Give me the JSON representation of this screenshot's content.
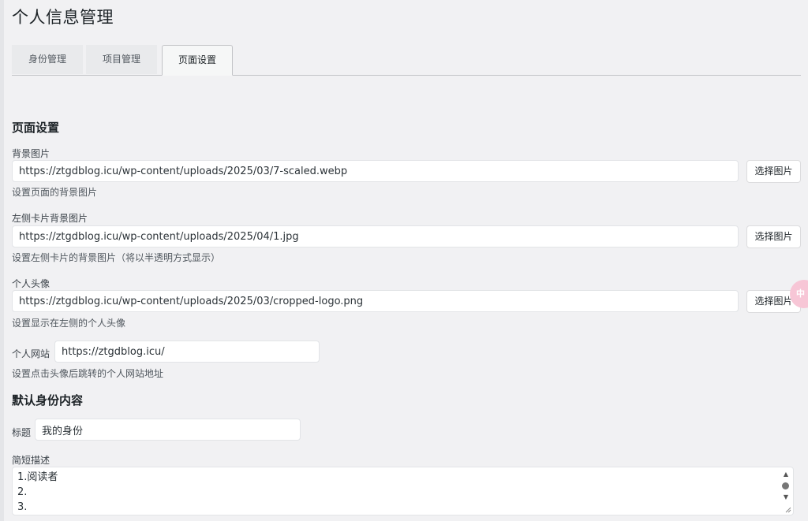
{
  "page": {
    "title": "个人信息管理"
  },
  "tabs": [
    {
      "label": "身份管理",
      "active": false
    },
    {
      "label": "项目管理",
      "active": false
    },
    {
      "label": "页面设置",
      "active": true
    }
  ],
  "page_settings": {
    "heading": "页面设置",
    "background_image": {
      "label": "背景图片",
      "value": "https://ztgdblog.icu/wp-content/uploads/2025/03/7-scaled.webp",
      "button": "选择图片",
      "description": "设置页面的背景图片"
    },
    "left_card_background": {
      "label": "左侧卡片背景图片",
      "value": "https://ztgdblog.icu/wp-content/uploads/2025/04/1.jpg",
      "button": "选择图片",
      "description": "设置左侧卡片的背景图片（将以半透明方式显示）"
    },
    "avatar": {
      "label": "个人头像",
      "value": "https://ztgdblog.icu/wp-content/uploads/2025/03/cropped-logo.png",
      "button": "选择图片",
      "description": "设置显示在左侧的个人头像"
    },
    "website": {
      "label": "个人网站",
      "value": "https://ztgdblog.icu/",
      "description": "设置点击头像后跳转的个人网站地址"
    }
  },
  "default_identity": {
    "heading": "默认身份内容",
    "title_label": "标题",
    "title_value": "我的身份",
    "summary_label": "简短描述",
    "summary_lines": [
      "1.阅读者",
      "2.",
      "3."
    ]
  },
  "widget": {
    "text": "中"
  },
  "colors": {
    "background": "#f1f1f3",
    "input_border": "#e2e4e7",
    "widget": "#f7c6d6"
  }
}
